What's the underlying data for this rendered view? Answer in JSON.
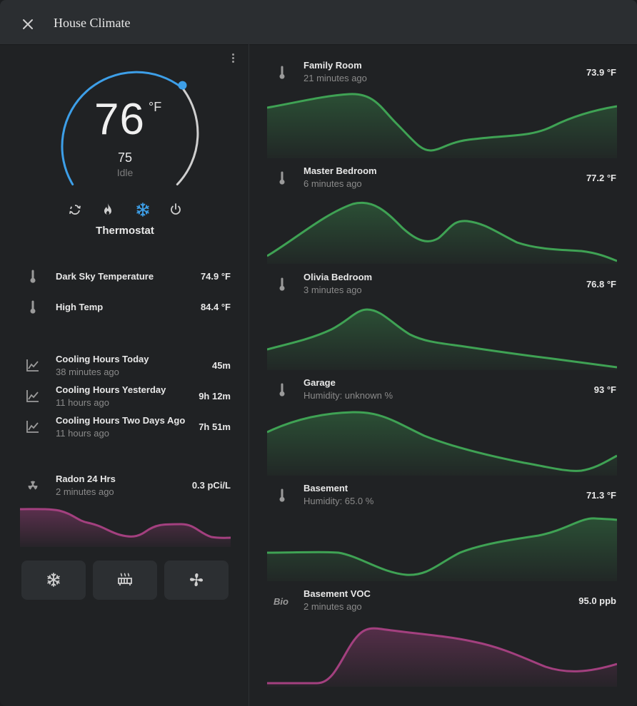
{
  "window": {
    "title": "House Climate"
  },
  "thermostat": {
    "current_temp": "76",
    "unit": "°F",
    "target_temp": "75",
    "state": "Idle",
    "name": "Thermostat",
    "modes": [
      "heat-cool-icon",
      "fire-icon",
      "snowflake-icon",
      "power-icon"
    ],
    "active_mode": "snowflake-icon",
    "colors": {
      "cool": "#3d9fe8",
      "track": "#cfcfcf"
    }
  },
  "sensors": [
    {
      "name": "Dark Sky Temperature",
      "value": "74.9 °F",
      "icon": "thermometer-icon"
    },
    {
      "name": "High Temp",
      "value": "84.4 °F",
      "icon": "thermometer-icon"
    }
  ],
  "cooling": [
    {
      "name": "Cooling Hours Today",
      "sub": "38 minutes ago",
      "value": "45m",
      "icon": "chart-line-icon"
    },
    {
      "name": "Cooling Hours Yesterday",
      "sub": "11 hours ago",
      "value": "9h 12m",
      "icon": "chart-line-icon"
    },
    {
      "name": "Cooling Hours Two Days Ago",
      "sub": "11 hours ago",
      "value": "7h 51m",
      "icon": "chart-line-icon"
    }
  ],
  "radon": {
    "name": "Radon 24 Hrs",
    "sub": "2 minutes ago",
    "value": "0.3 pCi/L",
    "icon": "radioactive-icon",
    "color": "#a3407f"
  },
  "controls": [
    "snowflake-icon",
    "radiator-icon",
    "fan-icon"
  ],
  "rooms": [
    {
      "name": "Family Room",
      "sub": "21 minutes ago",
      "value": "73.9 °F",
      "icon": "thermometer-icon",
      "color": "#3fa254"
    },
    {
      "name": "Master Bedroom",
      "sub": "6 minutes ago",
      "value": "77.2 °F",
      "icon": "thermometer-icon",
      "color": "#3fa254"
    },
    {
      "name": "Olivia Bedroom",
      "sub": "3 minutes ago",
      "value": "76.8 °F",
      "icon": "thermometer-icon",
      "color": "#3fa254"
    },
    {
      "name": "Garage",
      "sub": "Humidity: unknown %",
      "value": "93 °F",
      "icon": "thermometer-icon",
      "color": "#3fa254"
    },
    {
      "name": "Basement",
      "sub": "Humidity: 65.0 %",
      "value": "71.3 °F",
      "icon": "thermometer-icon",
      "color": "#3fa254"
    },
    {
      "name": "Basement VOC",
      "sub": "2 minutes ago",
      "value": "95.0 ppb",
      "icon": "bio-icon",
      "icon_text": "Bio",
      "color": "#a3407f"
    }
  ]
}
